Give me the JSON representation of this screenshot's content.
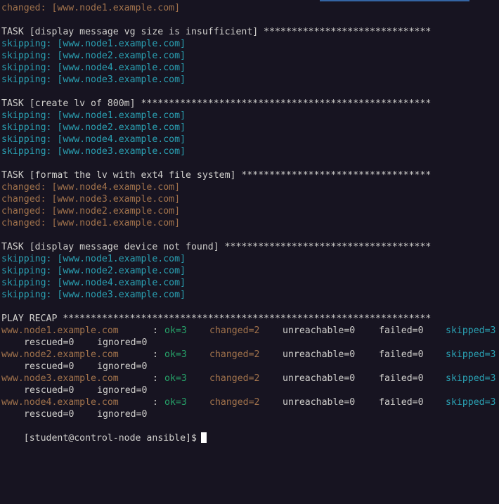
{
  "colors": {
    "background": "#171421",
    "changed": "#a2734c",
    "skipping": "#2aa1b3",
    "ok": "#26a269",
    "text": "#d0cfcc"
  },
  "lines": {
    "l0": "changed: [www.node1.example.com]",
    "t1": "TASK [display message vg size is insufficient] ******************************",
    "t1a": "skipping: [www.node1.example.com]",
    "t1b": "skipping: [www.node2.example.com]",
    "t1c": "skipping: [www.node4.example.com]",
    "t1d": "skipping: [www.node3.example.com]",
    "t2": "TASK [create lv of 800m] ****************************************************",
    "t2a": "skipping: [www.node1.example.com]",
    "t2b": "skipping: [www.node2.example.com]",
    "t2c": "skipping: [www.node4.example.com]",
    "t2d": "skipping: [www.node3.example.com]",
    "t3": "TASK [format the lv with ext4 file system] **********************************",
    "t3a": "changed: [www.node4.example.com]",
    "t3b": "changed: [www.node3.example.com]",
    "t3c": "changed: [www.node2.example.com]",
    "t3d": "changed: [www.node1.example.com]",
    "t4": "TASK [display message device not found] *************************************",
    "t4a": "skipping: [www.node1.example.com]",
    "t4b": "skipping: [www.node2.example.com]",
    "t4c": "skipping: [www.node4.example.com]",
    "t4d": "skipping: [www.node3.example.com]",
    "recap": "PLAY RECAP ******************************************************************"
  },
  "recap": {
    "colon": ":",
    "rows": [
      {
        "host": "www.node1.example.com",
        "ok": "ok=3",
        "changed": "changed=2",
        "unreachable": "unreachable=0",
        "failed": "failed=0",
        "skipped": "skipped=3",
        "rescued": "rescued=0",
        "ignored": "ignored=0"
      },
      {
        "host": "www.node2.example.com",
        "ok": "ok=3",
        "changed": "changed=2",
        "unreachable": "unreachable=0",
        "failed": "failed=0",
        "skipped": "skipped=3",
        "rescued": "rescued=0",
        "ignored": "ignored=0"
      },
      {
        "host": "www.node3.example.com",
        "ok": "ok=3",
        "changed": "changed=2",
        "unreachable": "unreachable=0",
        "failed": "failed=0",
        "skipped": "skipped=3",
        "rescued": "rescued=0",
        "ignored": "ignored=0"
      },
      {
        "host": "www.node4.example.com",
        "ok": "ok=3",
        "changed": "changed=2",
        "unreachable": "unreachable=0",
        "failed": "failed=0",
        "skipped": "skipped=3",
        "rescued": "rescued=0",
        "ignored": "ignored=0"
      }
    ]
  },
  "prompt": "[student@control-node ansible]$"
}
